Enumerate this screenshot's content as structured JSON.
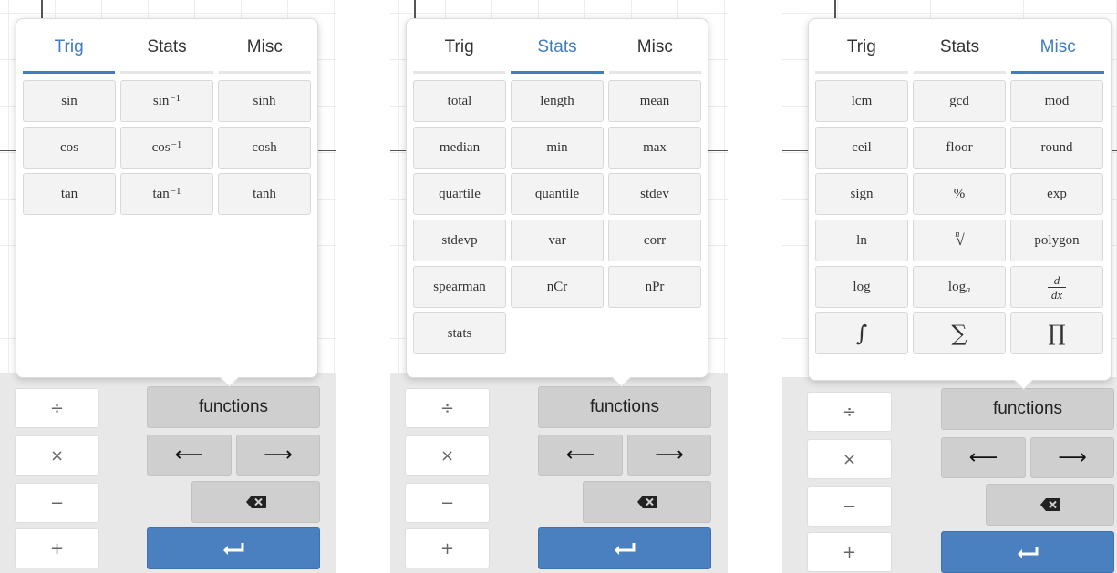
{
  "panels": [
    {
      "tabs": [
        {
          "label": "Trig",
          "active": true
        },
        {
          "label": "Stats",
          "active": false
        },
        {
          "label": "Misc",
          "active": false
        }
      ],
      "keys": [
        {
          "label": "sin"
        },
        {
          "label": "sin",
          "sup": "−1"
        },
        {
          "label": "sinh"
        },
        {
          "label": "cos"
        },
        {
          "label": "cos",
          "sup": "−1"
        },
        {
          "label": "cosh"
        },
        {
          "label": "tan"
        },
        {
          "label": "tan",
          "sup": "−1"
        },
        {
          "label": "tanh"
        }
      ]
    },
    {
      "tabs": [
        {
          "label": "Trig",
          "active": false
        },
        {
          "label": "Stats",
          "active": true
        },
        {
          "label": "Misc",
          "active": false
        }
      ],
      "keys": [
        {
          "label": "total"
        },
        {
          "label": "length"
        },
        {
          "label": "mean"
        },
        {
          "label": "median"
        },
        {
          "label": "min"
        },
        {
          "label": "max"
        },
        {
          "label": "quartile"
        },
        {
          "label": "quantile"
        },
        {
          "label": "stdev"
        },
        {
          "label": "stdevp"
        },
        {
          "label": "var"
        },
        {
          "label": "corr"
        },
        {
          "label": "spearman"
        },
        {
          "label": "nCr"
        },
        {
          "label": "nPr"
        },
        {
          "label": "stats"
        }
      ]
    },
    {
      "tabs": [
        {
          "label": "Trig",
          "active": false
        },
        {
          "label": "Stats",
          "active": false
        },
        {
          "label": "Misc",
          "active": true
        }
      ],
      "keys": [
        {
          "label": "lcm"
        },
        {
          "label": "gcd"
        },
        {
          "label": "mod"
        },
        {
          "label": "ceil"
        },
        {
          "label": "floor"
        },
        {
          "label": "round"
        },
        {
          "label": "sign"
        },
        {
          "label": "%"
        },
        {
          "label": "exp"
        },
        {
          "label": "ln"
        },
        {
          "label": "√",
          "rootIndex": "n"
        },
        {
          "label": "polygon"
        },
        {
          "label": "log"
        },
        {
          "label": "log",
          "sub": "a"
        },
        {
          "label": "dx",
          "fracTop": "d"
        },
        {
          "label": "∫",
          "big": true
        },
        {
          "label": "∑",
          "big": true
        },
        {
          "label": "∏",
          "big": true
        }
      ]
    }
  ],
  "keypad": {
    "divide": "÷",
    "times": "×",
    "minus": "−",
    "plus": "+",
    "functions": "functions",
    "left_arrow": "⟵",
    "right_arrow": "⟶"
  },
  "colors": {
    "accent": "#3f7cc1",
    "enter": "#4a80bf",
    "keypad_bg": "#e8e8e8",
    "dark_key": "#cfcfcf"
  },
  "icons": [
    "left-arrow-icon",
    "right-arrow-icon",
    "backspace-icon",
    "enter-icon"
  ]
}
